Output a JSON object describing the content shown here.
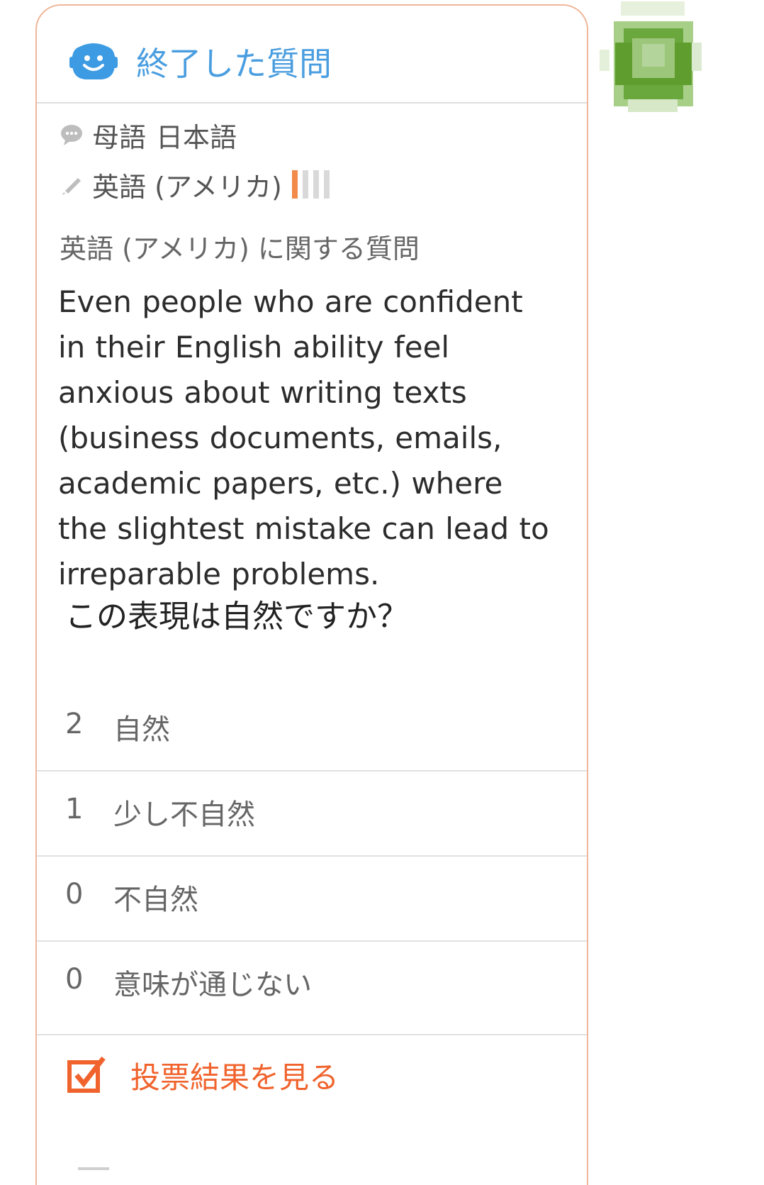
{
  "header": {
    "title": "終了した質問",
    "icon": "smiley-bubble-icon",
    "accent_color": "#4a9ee0"
  },
  "profile": {
    "native_label": "母語",
    "native_language": "日本語",
    "learning_language": "英語 (アメリカ)",
    "learning_level": 0.25
  },
  "question": {
    "category": "英語 (アメリカ) に関する質問",
    "text": "Even people who are confident in their English ability feel anxious about writing texts (business documents, emails, academic papers, etc.) where the slightest mistake can lead to irreparable problems.",
    "prompt": "この表現は自然ですか？"
  },
  "options": [
    {
      "count": "2",
      "label": "自然"
    },
    {
      "count": "1",
      "label": "少し不自然"
    },
    {
      "count": "0",
      "label": "不自然"
    },
    {
      "count": "0",
      "label": "意味が通じない"
    }
  ],
  "results": {
    "label": "投票結果を見る",
    "color": "#f0632d"
  }
}
